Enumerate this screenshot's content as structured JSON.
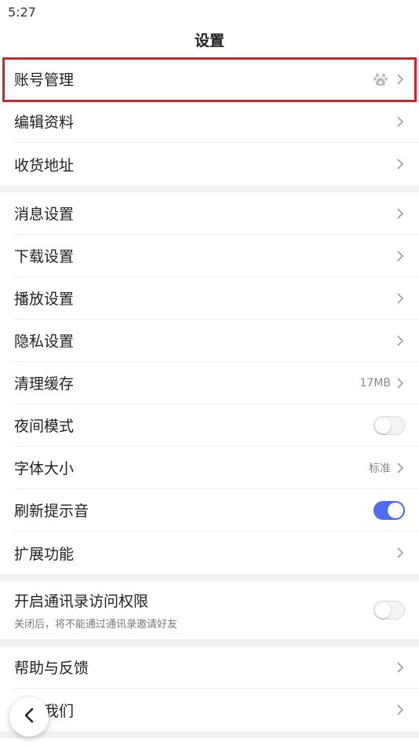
{
  "status": {
    "time": "5:27"
  },
  "header": {
    "title": "设置"
  },
  "sections": {
    "account": {
      "account_mgmt": "账号管理",
      "edit_profile": "编辑资料",
      "address": "收货地址"
    },
    "settings": {
      "message": "消息设置",
      "download": "下载设置",
      "playback": "播放设置",
      "privacy": "隐私设置",
      "clear_cache": "清理缓存",
      "cache_size": "17MB",
      "night_mode": "夜间模式",
      "night_mode_on": false,
      "font_size": "字体大小",
      "font_size_value": "标准",
      "refresh_sound": "刷新提示音",
      "refresh_sound_on": true,
      "extensions": "扩展功能"
    },
    "contacts": {
      "label": "开启通讯录访问权限",
      "sub": "关闭后，将不能通过通讯录邀请好友",
      "enabled": false
    },
    "about": {
      "help": "帮助与反馈",
      "about_us": "关于我们"
    }
  },
  "colors": {
    "accent": "#4e6ef2",
    "highlight": "#e11d1d",
    "gap": "#f2f2f2"
  },
  "icons": {
    "chevron": "chevron-right-icon",
    "baidu": "baidu-paw-icon",
    "back": "back-arrow-icon"
  }
}
